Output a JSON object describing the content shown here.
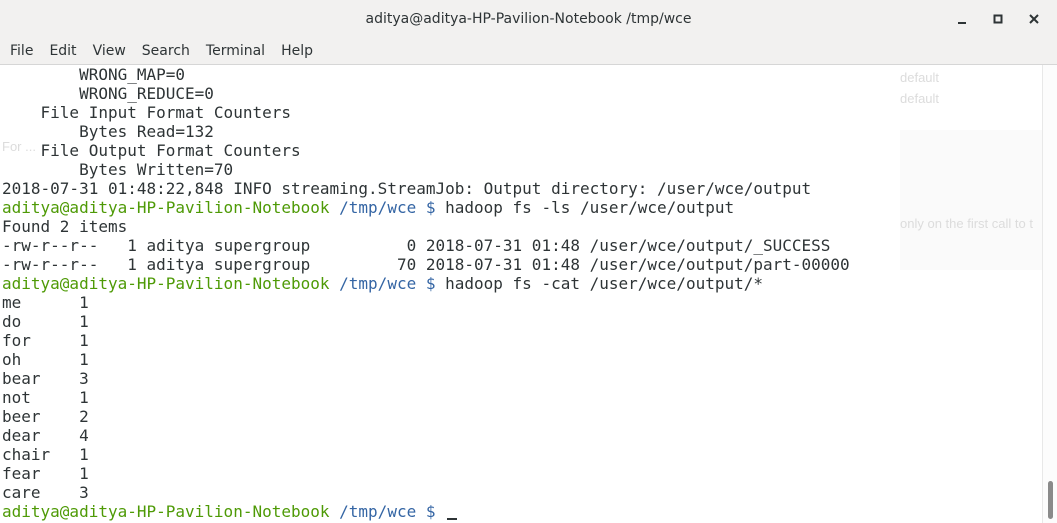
{
  "window": {
    "title": "aditya@aditya-HP-Pavilion-Notebook /tmp/wce",
    "buttons": [
      "minimize",
      "maximize",
      "close"
    ]
  },
  "menu": [
    "File",
    "Edit",
    "View",
    "Search",
    "Terminal",
    "Help"
  ],
  "background_ghost": [
    "default",
    "default",
    "For ...",
    "only on the first call to t"
  ],
  "terminal": {
    "lines": [
      {
        "text": "        WRONG_MAP=0"
      },
      {
        "text": "        WRONG_REDUCE=0"
      },
      {
        "text": "    File Input Format Counters"
      },
      {
        "text": "        Bytes Read=132"
      },
      {
        "text": "    File Output Format Counters"
      },
      {
        "text": "        Bytes Written=70"
      },
      {
        "text": "2018-07-31 01:48:22,848 INFO streaming.StreamJob: Output directory: /user/wce/output"
      },
      {
        "prompt_user": "aditya@aditya-HP-Pavilion-Notebook",
        "prompt_path": "/tmp/wce",
        "prompt_symbol": "$",
        "command": "hadoop fs -ls /user/wce/output"
      },
      {
        "text": "Found 2 items"
      },
      {
        "text": "-rw-r--r--   1 aditya supergroup          0 2018-07-31 01:48 /user/wce/output/_SUCCESS"
      },
      {
        "text": "-rw-r--r--   1 aditya supergroup         70 2018-07-31 01:48 /user/wce/output/part-00000"
      },
      {
        "prompt_user": "aditya@aditya-HP-Pavilion-Notebook",
        "prompt_path": "/tmp/wce",
        "prompt_symbol": "$",
        "command": "hadoop fs -cat /user/wce/output/*"
      },
      {
        "text": "me      1"
      },
      {
        "text": "do      1"
      },
      {
        "text": "for     1"
      },
      {
        "text": "oh      1"
      },
      {
        "text": "bear    3"
      },
      {
        "text": "not     1"
      },
      {
        "text": "beer    2"
      },
      {
        "text": "dear    4"
      },
      {
        "text": "chair   1"
      },
      {
        "text": "fear    1"
      },
      {
        "text": "care    3"
      },
      {
        "prompt_user": "aditya@aditya-HP-Pavilion-Notebook",
        "prompt_path": "/tmp/wce",
        "prompt_symbol": "$",
        "command": "",
        "cursor": true
      }
    ]
  },
  "colors": {
    "prompt_user": "#4e9a06",
    "prompt_path": "#3465a4",
    "text": "#2e3436"
  }
}
